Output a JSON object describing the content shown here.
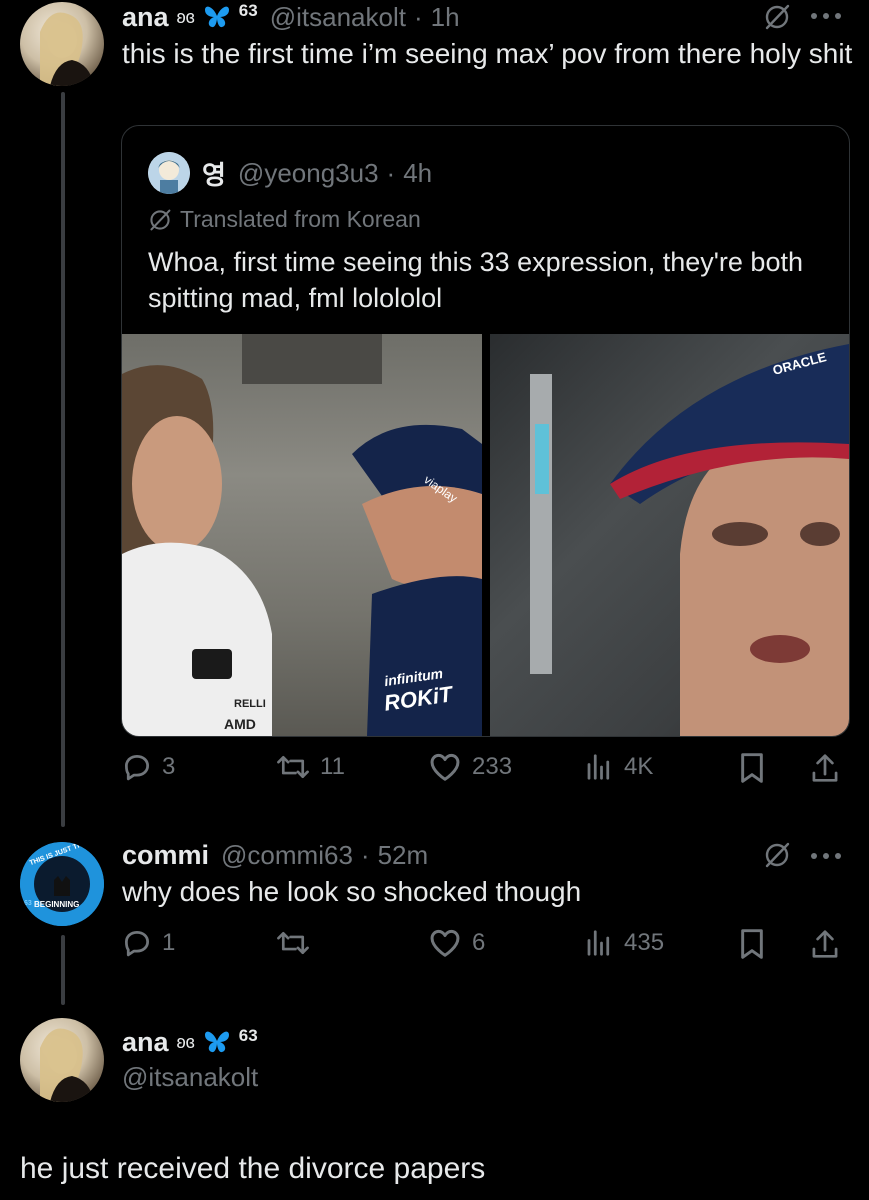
{
  "tweet1": {
    "name": "ana",
    "badges": "ʚɞ",
    "badge_num": "63",
    "handle": "@itsanakolt",
    "time": "1h",
    "text": "this is the first time i’m seeing max’ pov from there holy shit",
    "quote": {
      "name": "영",
      "handle": "@yeong3u3",
      "time": "4h",
      "translated": "Translated from Korean",
      "text": "Whoa, first time seeing this 33 expression, they're both spitting mad, fml lolololol",
      "photo_left_texts": [
        "ROKiT",
        "infinitum",
        "viaplay",
        "AMD",
        "RELLI"
      ],
      "photo_right_texts": [
        "ORACLE"
      ]
    },
    "stats": {
      "replies": "3",
      "reposts": "11",
      "likes": "233",
      "views": "4K"
    }
  },
  "tweet2": {
    "name": "commi",
    "handle": "@commi63",
    "time": "52m",
    "text": "why does he look so shocked though",
    "avatar_text_top": "THIS IS JUST THE",
    "avatar_text_bottom": "BEGINNING",
    "avatar_num": "63",
    "stats": {
      "replies": "1",
      "reposts": "",
      "likes": "6",
      "views": "435"
    }
  },
  "tweet3": {
    "name": "ana",
    "badges": "ʚɞ",
    "badge_num": "63",
    "handle": "@itsanakolt",
    "text": "he just received the divorce papers"
  },
  "colors": {
    "bg": "#000000",
    "text": "#e7e9ea",
    "muted": "#71767b",
    "accent_blue": "#1d9bf0",
    "butterfly": "#1d9bf0"
  }
}
